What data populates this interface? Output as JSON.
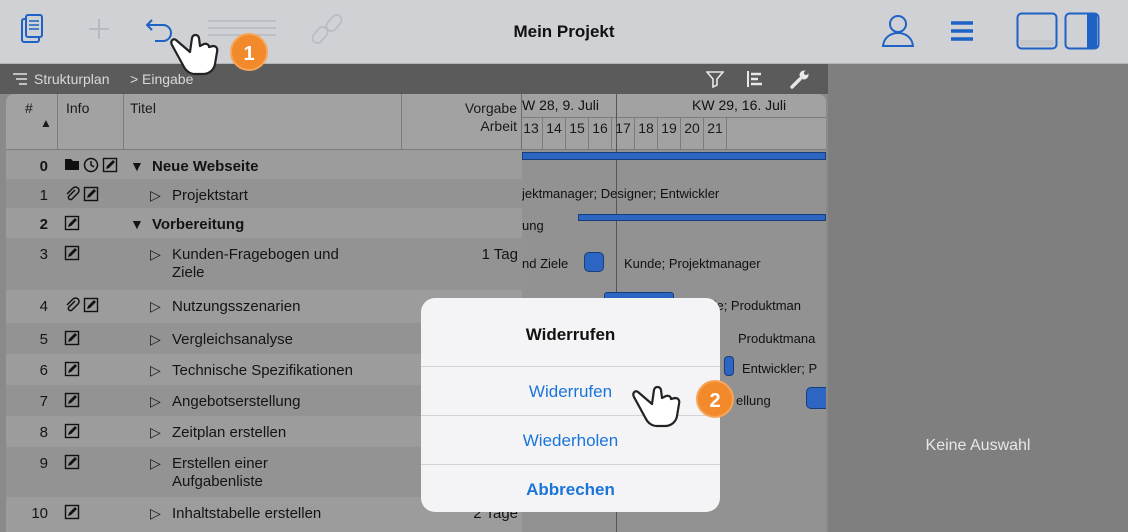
{
  "app": {
    "title": "Mein Projekt"
  },
  "toolbar": {
    "left_icons": [
      "document-icon",
      "plus-icon",
      "undo-icon",
      "indent-icon",
      "link-icon"
    ],
    "right_icons": [
      "user-icon",
      "menu-icon",
      "bottom-panel-icon",
      "right-panel-icon"
    ]
  },
  "breadcrumb": {
    "root": "Strukturplan",
    "separator": ">",
    "current": "Eingabe"
  },
  "table": {
    "columns": {
      "num": "#",
      "info": "Info",
      "title": "Titel",
      "work_line1": "Vorgabe",
      "work_line2": "Arbeit"
    },
    "rows": [
      {
        "num": "0",
        "title": "Neue Webseite",
        "arrow": "▼",
        "work": ""
      },
      {
        "num": "1",
        "title": "Projektstart",
        "arrow": "▷",
        "work": ""
      },
      {
        "num": "2",
        "title": "Vorbereitung",
        "arrow": "▼",
        "work": ""
      },
      {
        "num": "3",
        "title": "Kunden-Fragebogen und",
        "title2": "Ziele",
        "arrow": "▷",
        "work": "1 Tag"
      },
      {
        "num": "4",
        "title": "Nutzungsszenarien",
        "arrow": "▷",
        "work": ""
      },
      {
        "num": "5",
        "title": "Vergleichsanalyse",
        "arrow": "▷",
        "work": ""
      },
      {
        "num": "6",
        "title": "Technische Spezifikationen",
        "arrow": "▷",
        "work": ""
      },
      {
        "num": "7",
        "title": "Angebotserstellung",
        "arrow": "▷",
        "work": ""
      },
      {
        "num": "8",
        "title": "Zeitplan erstellen",
        "arrow": "▷",
        "work": ""
      },
      {
        "num": "9",
        "title": "Erstellen einer",
        "title2": "Aufgabenliste",
        "arrow": "▷",
        "work": ""
      },
      {
        "num": "10",
        "title": "Inhaltstabelle erstellen",
        "arrow": "▷",
        "work": "2 Tage"
      }
    ]
  },
  "gantt": {
    "weeks": [
      "W 28, 9. Juli",
      "KW 29, 16. Juli"
    ],
    "days": [
      "13",
      "14",
      "15",
      "16",
      "17",
      "18",
      "19",
      "20",
      "21"
    ],
    "labels": {
      "r1": "jektmanager; Designer; Entwickler",
      "r2": "ung",
      "r3a": "nd Ziele",
      "r3b": "Kunde; Projektmanager",
      "r4": "nde; Produktman",
      "r5": "Produktmana",
      "r6": "Entwickler; P",
      "r7": "ellung"
    },
    "bar_color": "#2d66c2"
  },
  "dialog": {
    "title": "Widerrufen",
    "undo": "Widerrufen",
    "redo": "Wiederholen",
    "cancel": "Abbrechen"
  },
  "markers": [
    "1",
    "2"
  ],
  "right_panel": {
    "empty_text": "Keine Auswahl"
  }
}
